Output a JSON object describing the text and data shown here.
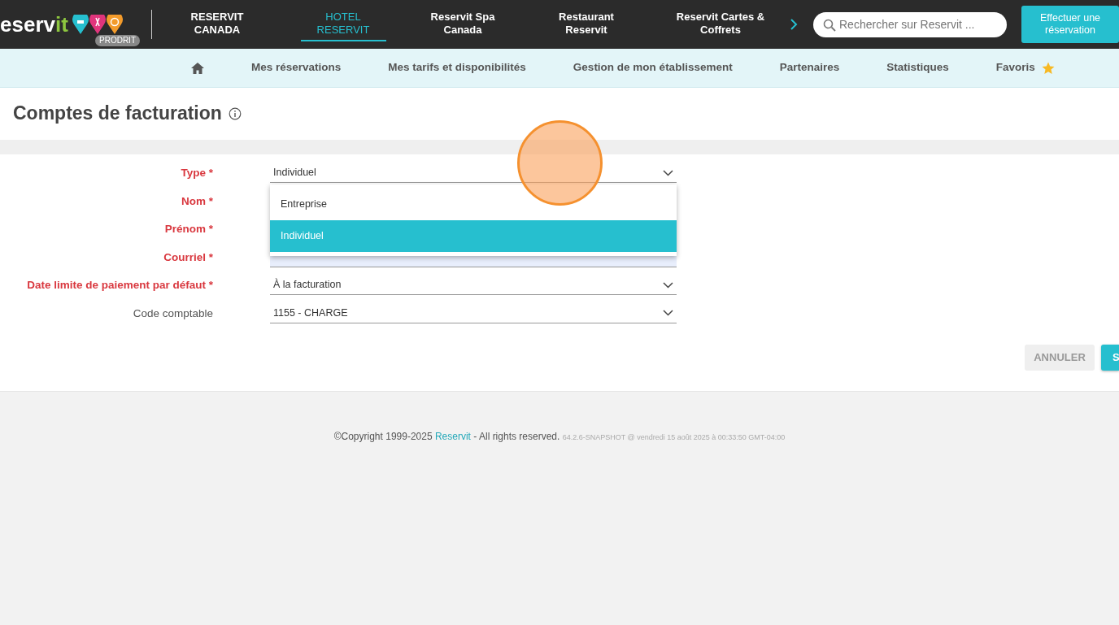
{
  "header": {
    "logo": {
      "main": "eserv",
      "accent": "it",
      "badge": "PRODRIT"
    },
    "tabs": [
      {
        "label": "RESERVIT CANADA",
        "selected": false
      },
      {
        "label": "HOTEL RESERVIT",
        "selected": true
      },
      {
        "label": "Reservit Spa Canada",
        "selected": false
      },
      {
        "label": "Restaurant Reservit",
        "selected": false
      },
      {
        "label": "Reservit Cartes & Coffrets",
        "selected": false
      }
    ],
    "search": {
      "placeholder": "Rechercher sur Reservit ..."
    },
    "cta": "Effectuer une réservation"
  },
  "subnav": [
    "Mes réservations",
    "Mes tarifs et disponibilités",
    "Gestion de mon établissement",
    "Partenaires",
    "Statistiques",
    "Favoris"
  ],
  "page_title": "Comptes de facturation",
  "form": {
    "fields": [
      {
        "label": "Type *",
        "required": true,
        "kind": "select",
        "value": "Individuel"
      },
      {
        "label": "Nom *",
        "required": true,
        "kind": "text"
      },
      {
        "label": "Prénom *",
        "required": true,
        "kind": "text"
      },
      {
        "label": "Courriel *",
        "required": true,
        "kind": "text",
        "autofilled": true
      },
      {
        "label": "Date limite de paiement par défaut *",
        "required": true,
        "kind": "select",
        "value": "À la facturation"
      },
      {
        "label": "Code comptable",
        "required": false,
        "kind": "select",
        "value": "1155 - CHARGE"
      }
    ],
    "dropdown": [
      {
        "label": "Entreprise",
        "selected": false
      },
      {
        "label": "Individuel",
        "selected": true
      }
    ],
    "buttons": [
      {
        "label": "ANNULER",
        "kind": "secondary"
      },
      {
        "label": "S",
        "kind": "primary"
      }
    ]
  },
  "footer": {
    "copyright": "©Copyright 1999-2025",
    "link": "Reservit",
    "rights": "- All rights reserved.",
    "version": "64.2.6-SNAPSHOT @ vendredi 15 août 2025 à 00:33:50 GMT-04:00"
  }
}
